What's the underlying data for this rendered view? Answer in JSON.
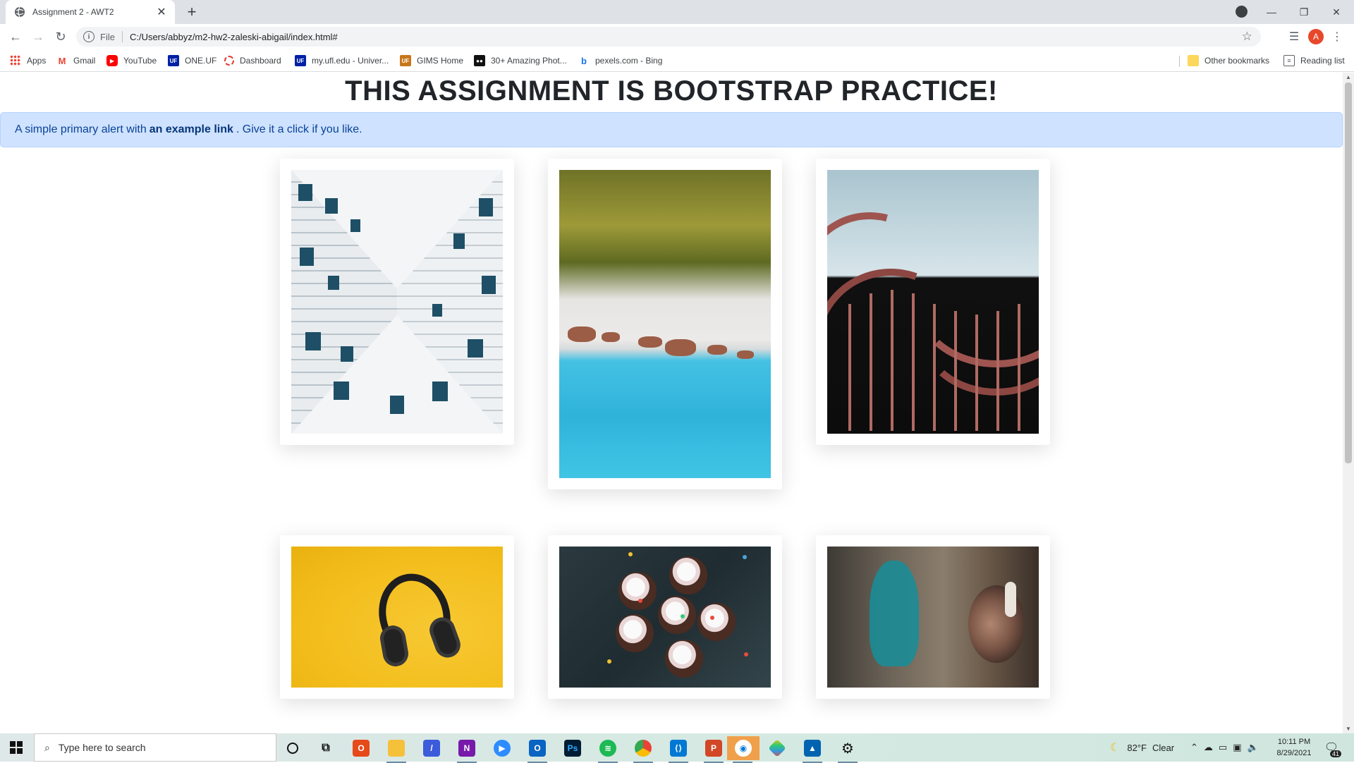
{
  "browser": {
    "tab_title": "Assignment 2 - AWT2",
    "tab_close": "✕",
    "new_tab": "+",
    "url_scheme": "File",
    "url": "C:/Users/abbyz/m2-hw2-zaleski-abigail/index.html#",
    "profile_initial": "A",
    "accent": "#e8472b"
  },
  "bookmarks": {
    "items": [
      {
        "label": "Apps",
        "icon": "apps-grid-icon"
      },
      {
        "label": "Gmail",
        "icon": "gmail-icon"
      },
      {
        "label": "YouTube",
        "icon": "youtube-icon"
      },
      {
        "label": "ONE.UF",
        "icon": "uf-icon"
      },
      {
        "label": "Dashboard",
        "icon": "dashboard-icon"
      },
      {
        "label": "my.ufl.edu - Univer...",
        "icon": "uf-icon"
      },
      {
        "label": "GIMS Home",
        "icon": "gims-icon"
      },
      {
        "label": "30+ Amazing Phot...",
        "icon": "photo-site-icon"
      },
      {
        "label": "pexels.com - Bing",
        "icon": "bing-icon"
      }
    ],
    "other_bookmarks": "Other bookmarks",
    "reading_list": "Reading list"
  },
  "page": {
    "title": "THIS ASSIGNMENT IS BOOTSTRAP PRACTICE!",
    "alert": {
      "before_link": "A simple primary alert with",
      "link": "an example link",
      "after_link": ". Give it a click if you like.",
      "bg_color": "#cfe2ff"
    },
    "images": [
      {
        "subject": "building-corridor-photo"
      },
      {
        "subject": "beach-aerial-photo"
      },
      {
        "subject": "curved-building-photo"
      },
      {
        "subject": "headphones-photo"
      },
      {
        "subject": "cupcakes-photo"
      },
      {
        "subject": "graffiti-photo"
      }
    ]
  },
  "taskbar": {
    "search_placeholder": "Type here to search",
    "weather_temp": "82°F",
    "weather_cond": "Clear",
    "time": "10:11 PM",
    "date": "8/29/2021",
    "notification_count": "41"
  }
}
